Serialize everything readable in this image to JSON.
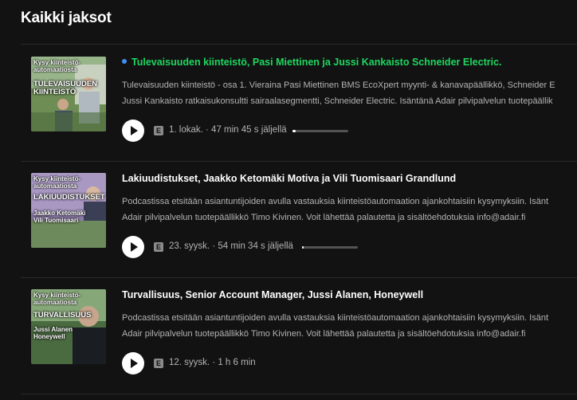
{
  "section_title": "Kaikki jaksot",
  "episodes": [
    {
      "title": "Tulevaisuuden kiinteistö, Pasi Miettinen ja Jussi Kankaisto Schneider Electric.",
      "is_new": true,
      "description_line1": "Tulevaisuuden kiinteistö - osa 1. Vieraina Pasi Miettinen BMS EcoXpert myynti- & kanavapäällikkö, Schneider E",
      "description_line2": "Jussi Kankaisto ratkaisukonsultti sairaalasegmentti, Schneider Electric. Isäntänä Adair pilvipalvelun tuotepäällik",
      "explicit": "E",
      "meta": "1. lokak. · 47 min 45 s jäljellä",
      "progress_fraction": 0.05,
      "thumb": {
        "top_text": "Kysy kiinteistö-\nautomaatiosta",
        "big_text": "TULEVAISUUDEN\nKIINTEISTÖ",
        "names": ""
      }
    },
    {
      "title": "Lakiuudistukset, Jaakko Ketomäki Motiva ja Vili Tuomisaari Grandlund",
      "is_new": false,
      "description_line1": "Podcastissa etsitään asiantuntijoiden avulla vastauksia kiinteistöautomaation ajankohtaisiin kysymyksiin. Isänt",
      "description_line2": "Adair pilvipalvelun tuotepäällikkö Timo Kivinen. Voit lähettää palautetta ja sisältöehdotuksia info@adair.fi",
      "explicit": "E",
      "meta": "23. syysk. · 54 min 34 s jäljellä",
      "progress_fraction": 0.03,
      "thumb": {
        "top_text": "Kysy kiinteistö-\nautomaatiosta",
        "big_text": "LAKIUUDISTUKSET",
        "names": "Jaakko Ketomäki\nVili Tuomisaari"
      }
    },
    {
      "title": "Turvallisuus, Senior Account Manager, Jussi Alanen, Honeywell",
      "is_new": false,
      "description_line1": "Podcastissa etsitään asiantuntijoiden avulla vastauksia kiinteistöautomaation ajankohtaisiin kysymyksiin. Isänt",
      "description_line2": "Adair pilvipalvelun tuotepäällikkö Timo Kivinen. Voit lähettää palautetta ja sisältöehdotuksia info@adair.fi",
      "explicit": "E",
      "meta": "12. syysk. · 1 h 6 min",
      "progress_fraction": null,
      "thumb": {
        "top_text": "Kysy kiinteistö-\nautomaatiosta",
        "big_text": "TURVALLISUUS",
        "names": "Jussi Alanen\nHoneywell"
      }
    }
  ],
  "colors": {
    "background": "#121212",
    "accent_green": "#1ed760",
    "new_dot": "#3d91f4",
    "muted": "#b3b3b3"
  },
  "icons": {
    "play": "play-icon",
    "explicit": "explicit-badge"
  }
}
